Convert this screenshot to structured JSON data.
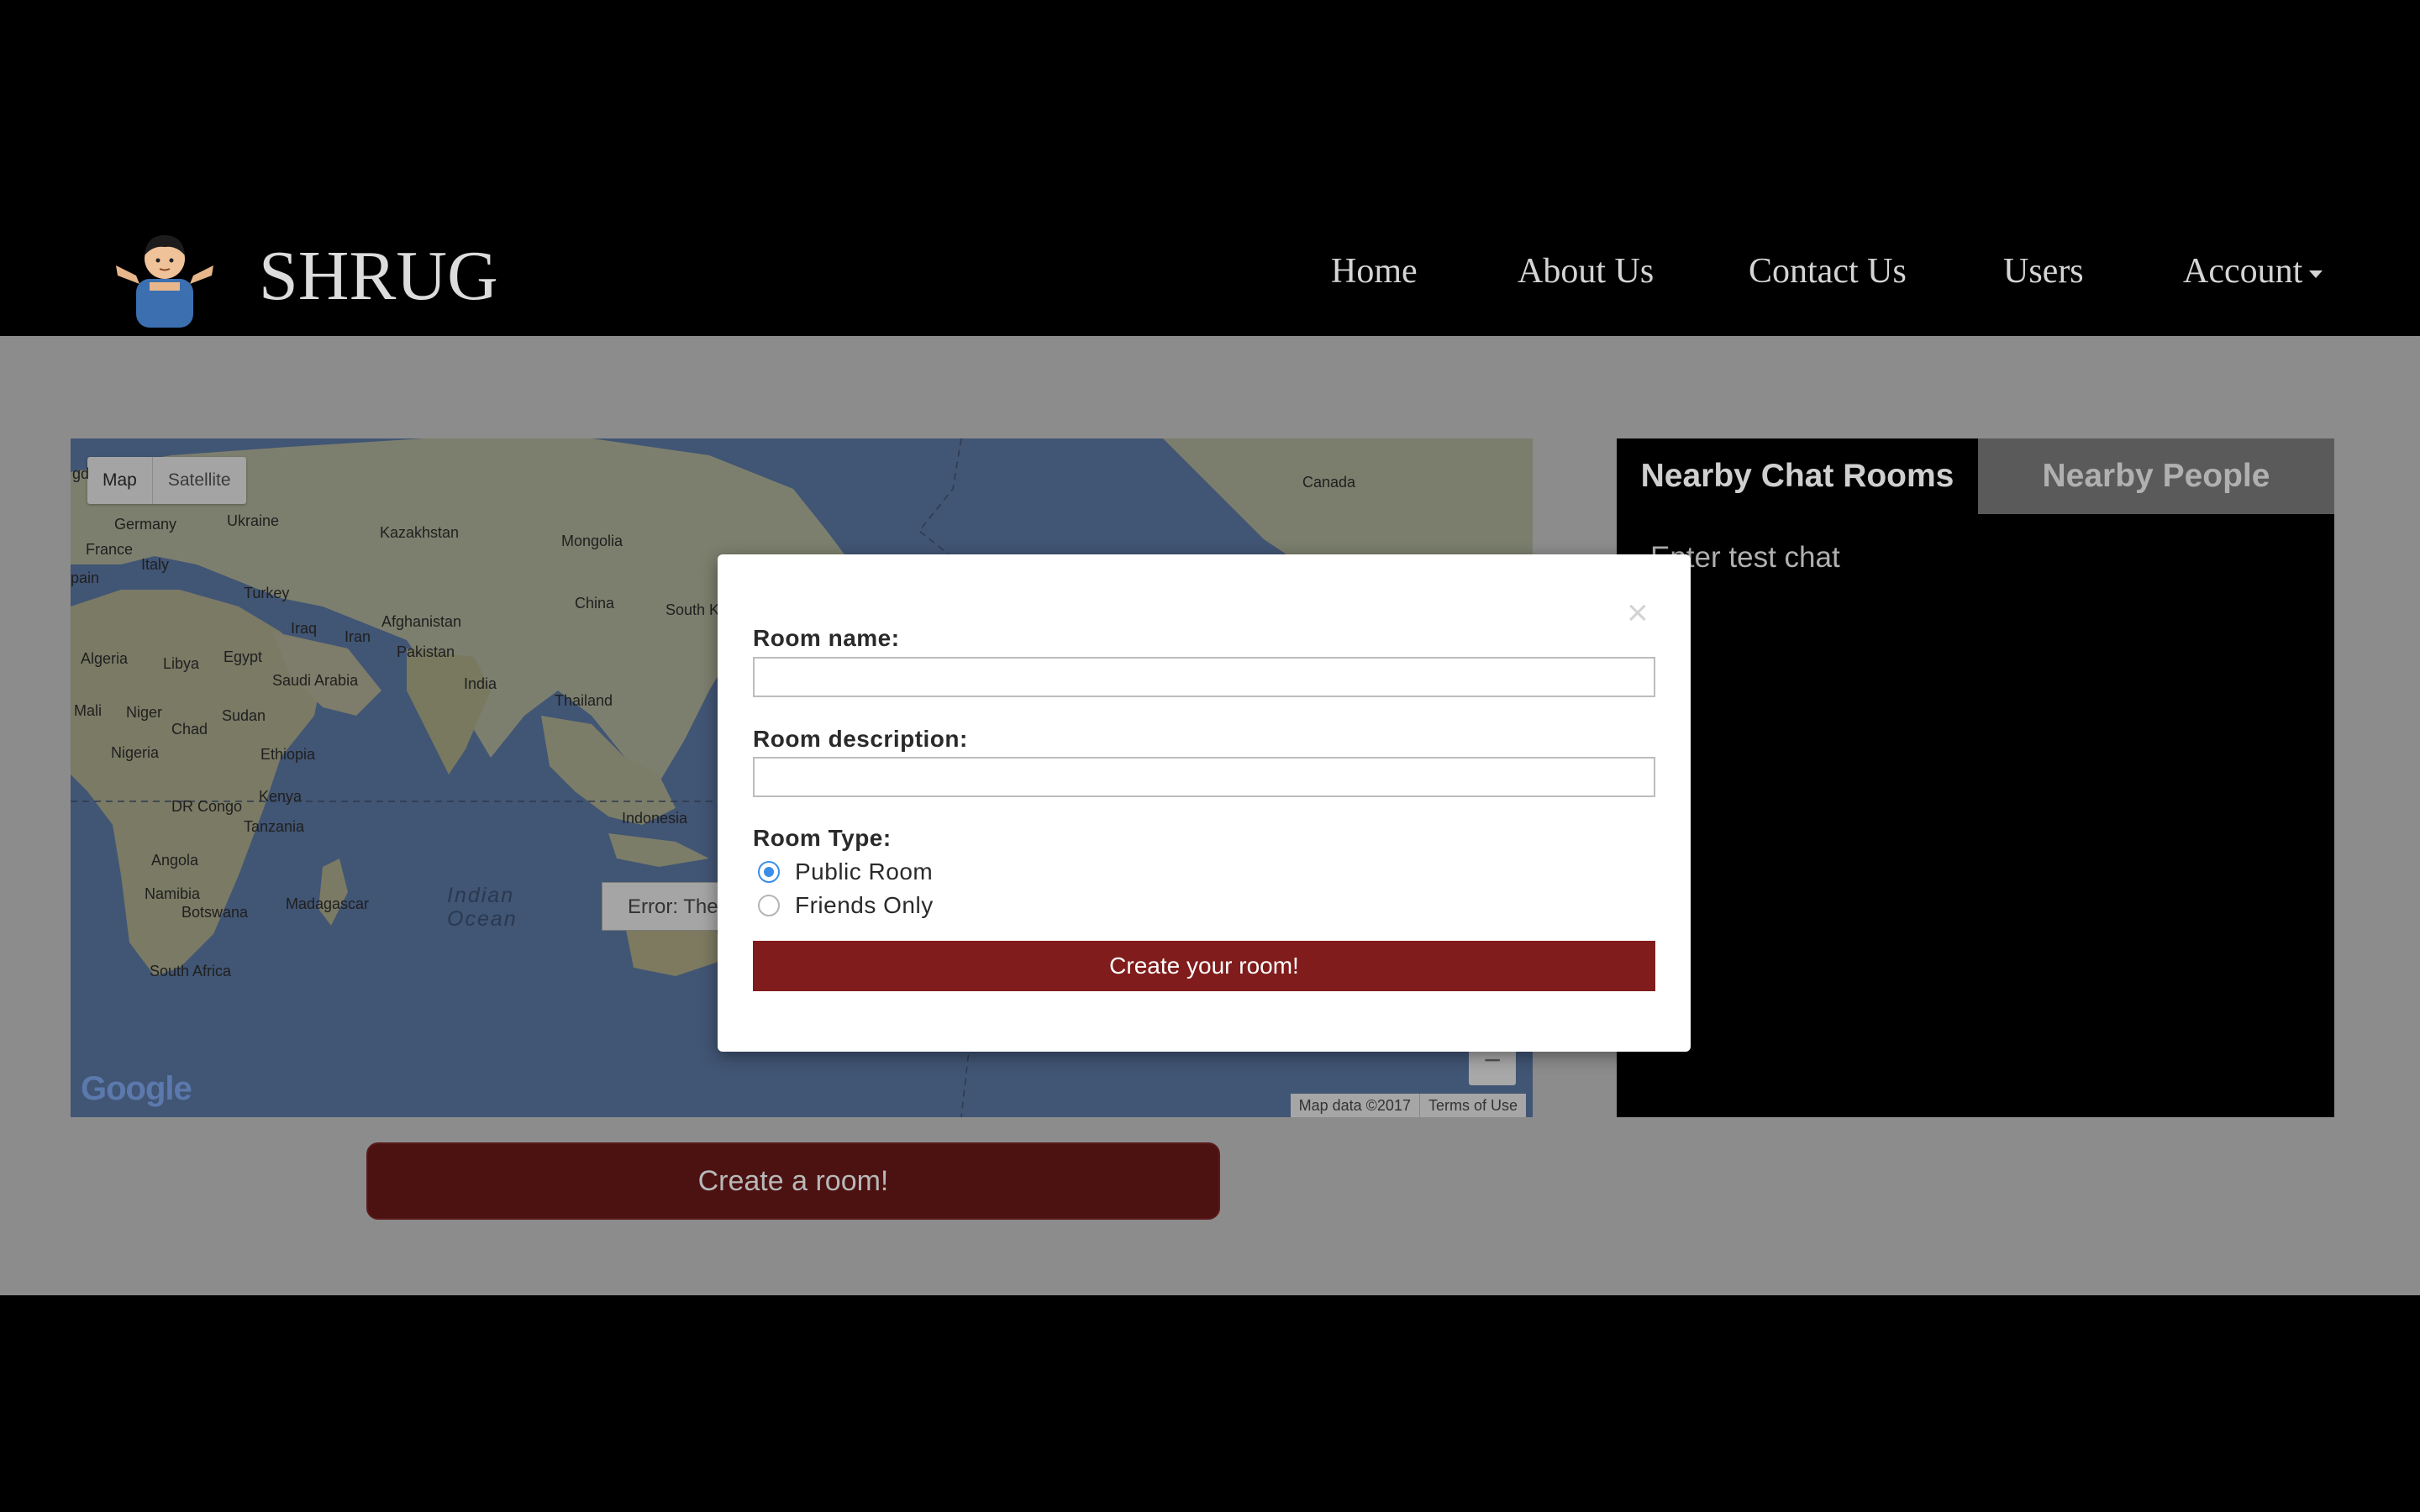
{
  "header": {
    "brand": "SHRUG",
    "nav": [
      {
        "label": "Home"
      },
      {
        "label": "About Us"
      },
      {
        "label": "Contact Us"
      },
      {
        "label": "Users"
      },
      {
        "label": "Account"
      }
    ]
  },
  "map": {
    "type_buttons": [
      "Map",
      "Satellite"
    ],
    "labels": {
      "canada": "Canada",
      "germany": "Germany",
      "ukraine": "Ukraine",
      "france": "France",
      "kazakhstan": "Kazakhstan",
      "mongolia": "Mongolia",
      "italy": "Italy",
      "spain": "pain",
      "turkey": "Turkey",
      "china": "China",
      "south_korea": "South K",
      "afghanistan": "Afghanistan",
      "iraq": "Iraq",
      "iran": "Iran",
      "pakistan": "Pakistan",
      "algeria": "Algeria",
      "libya": "Libya",
      "egypt": "Egypt",
      "saudi": "Saudi Arabia",
      "india": "India",
      "thailand": "Thailand",
      "mali": "Mali",
      "niger": "Niger",
      "chad": "Chad",
      "sudan": "Sudan",
      "nigeria": "Nigeria",
      "ethiopia": "Ethiopia",
      "kenya": "Kenya",
      "drc": "DR Congo",
      "tanzania": "Tanzania",
      "indonesia": "Indonesia",
      "angola": "Angola",
      "namibia": "Namibia",
      "botswana": "Botswana",
      "madagascar": "Madagascar",
      "south_africa": "South Africa",
      "indian_ocean_1": "Indian",
      "indian_ocean_2": "Ocean",
      "gd": "gd"
    },
    "error_text": "Error: The",
    "google": "Google",
    "footer_data": "Map data ©2017",
    "footer_terms": "Terms of Use",
    "zoom_out": "−"
  },
  "create_room_button": "Create a room!",
  "chat": {
    "tabs": [
      "Nearby Chat Rooms",
      "Nearby People"
    ],
    "items": [
      "Enter test chat"
    ]
  },
  "modal": {
    "close": "×",
    "room_name_label": "Room name:",
    "room_name_value": "",
    "room_desc_label": "Room description:",
    "room_desc_value": "",
    "room_type_label": "Room Type:",
    "options": [
      {
        "label": "Public Room",
        "checked": true
      },
      {
        "label": "Friends Only",
        "checked": false
      }
    ],
    "submit": "Create your room!"
  },
  "colors": {
    "overlay_page": "#8c8c8c",
    "modal_button": "#801c1c",
    "radio_accent": "#3b8ee8"
  }
}
